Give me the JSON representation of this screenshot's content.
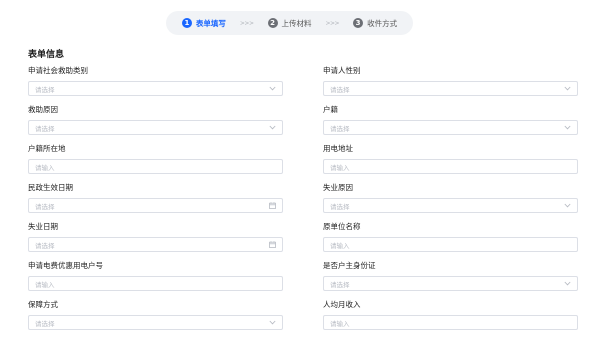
{
  "steps": [
    {
      "num": "1",
      "label": "表单填写",
      "active": true
    },
    {
      "num": "2",
      "label": "上传材料",
      "active": false
    },
    {
      "num": "3",
      "label": "收件方式",
      "active": false
    }
  ],
  "step_separator": ">>>",
  "section": {
    "title": "表单信息"
  },
  "form": {
    "rows": [
      [
        {
          "label": "申请社会救助类别",
          "placeholder": "请选择",
          "icon": "chevron-down-icon"
        },
        {
          "label": "申请人性别",
          "placeholder": "请选择",
          "icon": "chevron-down-icon"
        }
      ],
      [
        {
          "label": "救助原因",
          "placeholder": "请选择",
          "icon": "chevron-down-icon"
        },
        {
          "label": "户籍",
          "placeholder": "请选择",
          "icon": "chevron-down-icon"
        }
      ],
      [
        {
          "label": "户籍所在地",
          "placeholder": "请输入",
          "icon": ""
        },
        {
          "label": "用电地址",
          "placeholder": "请输入",
          "icon": ""
        }
      ],
      [
        {
          "label": "民政生效日期",
          "placeholder": "请选择",
          "icon": "calendar-icon"
        },
        {
          "label": "失业原因",
          "placeholder": "请选择",
          "icon": "chevron-down-icon"
        }
      ],
      [
        {
          "label": "失业日期",
          "placeholder": "请选择",
          "icon": "calendar-icon"
        },
        {
          "label": "原单位名称",
          "placeholder": "请输入",
          "icon": ""
        }
      ],
      [
        {
          "label": "申请电费优惠用电户号",
          "placeholder": "请输入",
          "icon": ""
        },
        {
          "label": "是否户主身份证",
          "placeholder": "请选择",
          "icon": "chevron-down-icon"
        }
      ],
      [
        {
          "label": "保障方式",
          "placeholder": "请选择",
          "icon": "chevron-down-icon"
        },
        {
          "label": "人均月收入",
          "placeholder": "请输入",
          "icon": ""
        }
      ]
    ]
  },
  "colors": {
    "accent": "#1a66ff",
    "border": "#dcdfe6",
    "placeholder": "#b8bcc4",
    "step_bar_bg": "#f1f3f6"
  }
}
